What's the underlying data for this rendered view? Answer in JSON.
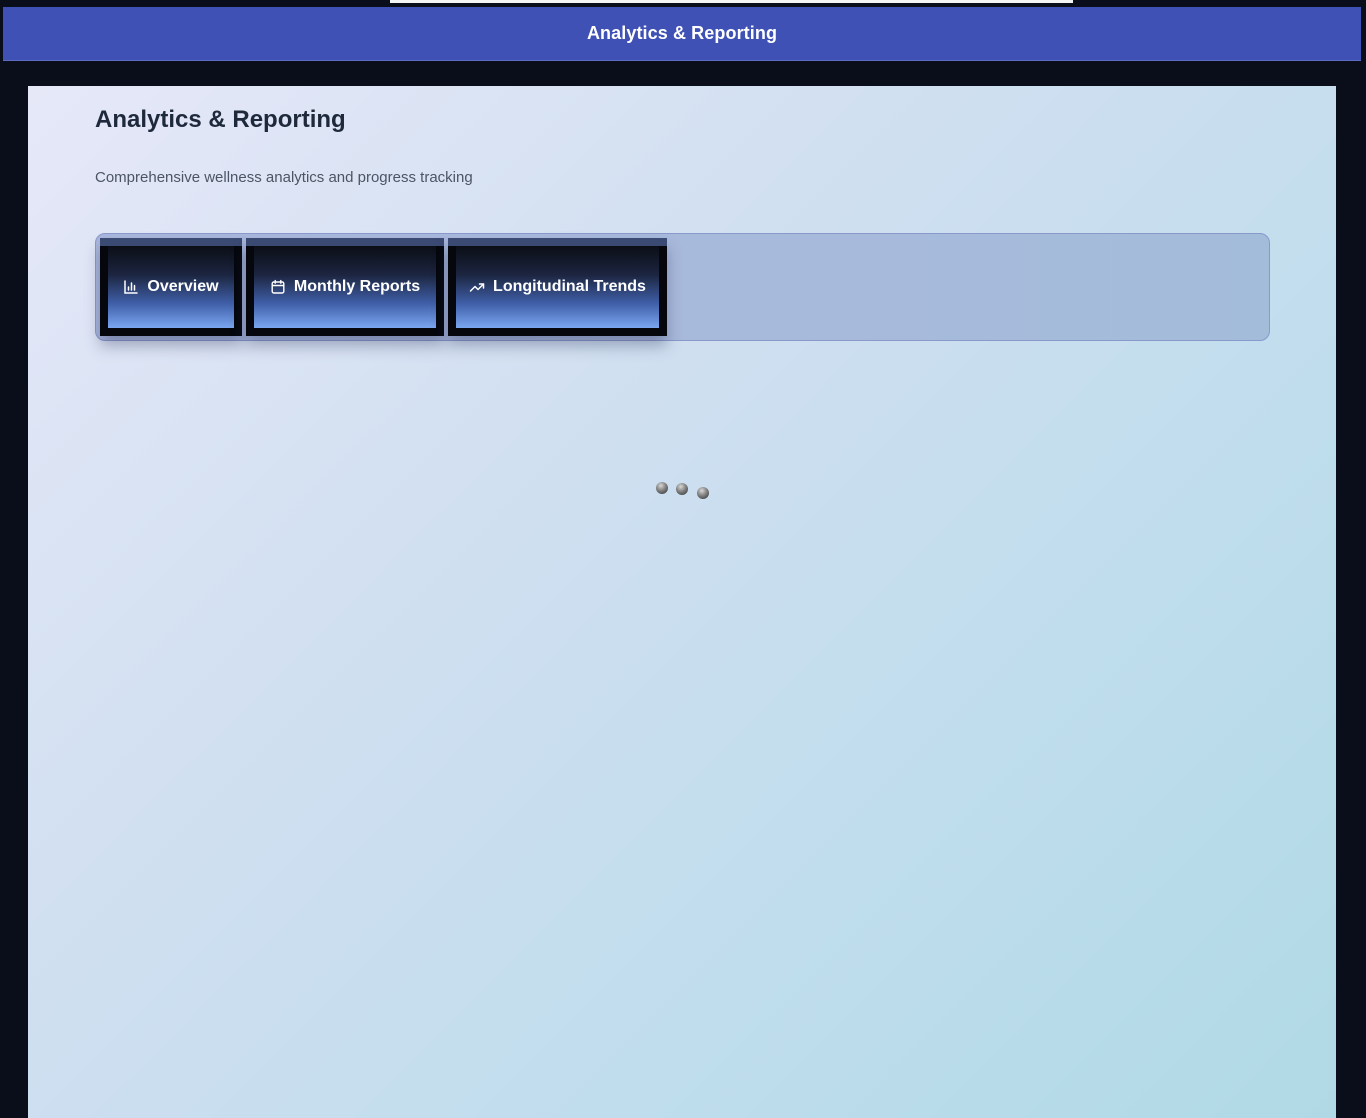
{
  "header": {
    "title": "Analytics & Reporting"
  },
  "page": {
    "title": "Analytics & Reporting",
    "subtitle": "Comprehensive wellness analytics and progress tracking"
  },
  "tabs": [
    {
      "label": "Overview",
      "icon": "bar-chart-icon"
    },
    {
      "label": "Monthly Reports",
      "icon": "calendar-icon"
    },
    {
      "label": "Longitudinal Trends",
      "icon": "trending-up-icon"
    }
  ],
  "loader": {
    "state": "loading"
  },
  "colors": {
    "header_bg": "#3f51b5",
    "frame_bg": "#0a0e1a",
    "title_text": "#1e293b",
    "subtitle_text": "#4b5563",
    "tab_accent": "#7aa6f0"
  }
}
